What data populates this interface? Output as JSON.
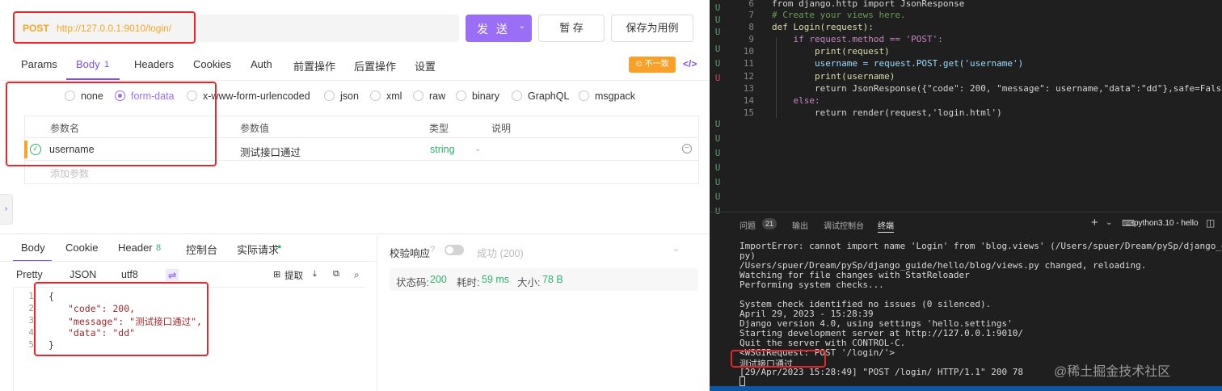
{
  "request": {
    "method": "POST",
    "url": "http://127.0.0.1:9010/login/",
    "send_label": "发 送",
    "draft_label": "暂 存",
    "save_case_label": "保存为用例"
  },
  "req_tabs": {
    "params": "Params",
    "body": "Body",
    "body_count": "1",
    "headers": "Headers",
    "cookies": "Cookies",
    "auth": "Auth",
    "pre": "前置操作",
    "post": "后置操作",
    "settings": "设置",
    "mismatch": "不一致",
    "code_icon": "</>"
  },
  "body_types": [
    "none",
    "form-data",
    "x-www-form-urlencoded",
    "json",
    "xml",
    "raw",
    "binary",
    "GraphQL",
    "msgpack"
  ],
  "params_table": {
    "headers": [
      "参数名",
      "参数值",
      "类型",
      "说明"
    ],
    "row": {
      "name": "username",
      "value": "测试接口通过",
      "type": "string"
    },
    "add_placeholder": "添加参数"
  },
  "resp_tabs": {
    "body": "Body",
    "cookie": "Cookie",
    "header": "Header",
    "header_count": "8",
    "console": "控制台",
    "actual": "实际请求"
  },
  "resp_toolbar": {
    "pretty": "Pretty",
    "format": "JSON",
    "encoding": "utf8",
    "extract": "提取"
  },
  "validate": {
    "label": "校验响应",
    "result": "成功 (200)"
  },
  "status": {
    "code_label": "状态码:",
    "code": "200",
    "time_label": "耗时:",
    "time": "59 ms",
    "size_label": "大小:",
    "size": "78 B"
  },
  "response_lines": [
    "{",
    "\"code\": 200,",
    "\"message\": \"测试接口通过\",",
    "\"data\": \"dd\"",
    "}"
  ],
  "editor": {
    "line_numbers": [
      "6",
      "7",
      "8",
      "9",
      "10",
      "11",
      "12",
      "13",
      "14",
      "15"
    ],
    "lines": [
      "from django.http import JsonResponse",
      "# Create your views here.",
      "def Login(request):",
      "    if request.method == 'POST':",
      "        print(request)",
      "        username = request.POST.get('username')",
      "        print(username)",
      "        return JsonResponse({\"code\": 200, \"message\": username,\"data\":\"dd\"},safe=False)",
      "    else:",
      "        return render(request,'login.html')"
    ]
  },
  "panel": {
    "problems": "问题",
    "problems_count": "21",
    "output": "输出",
    "debug_console": "调试控制台",
    "terminal": "终端",
    "shell": "python3.10 - hello"
  },
  "terminal_lines": [
    "ImportError: cannot import name 'Login' from 'blog.views' (/Users/spuer/Dream/pySp/django_guide/hello",
    "py)",
    "/Users/spuer/Dream/pySp/django_guide/hello/blog/views.py changed, reloading.",
    "Watching for file changes with StatReloader",
    "Performing system checks...",
    "",
    "System check identified no issues (0 silenced).",
    "April 29, 2023 - 15:28:39",
    "Django version 4.0, using settings 'hello.settings'",
    "Starting development server at http://127.0.0.1:9010/",
    "Quit the server with CONTROL-C.",
    "<WSGIRequest: POST '/login/'>",
    "测试接口通过",
    "[29/Apr/2023 15:28:49] \"POST /login/ HTTP/1.1\" 200 78"
  ],
  "watermark": "@稀土掘金技术社区"
}
